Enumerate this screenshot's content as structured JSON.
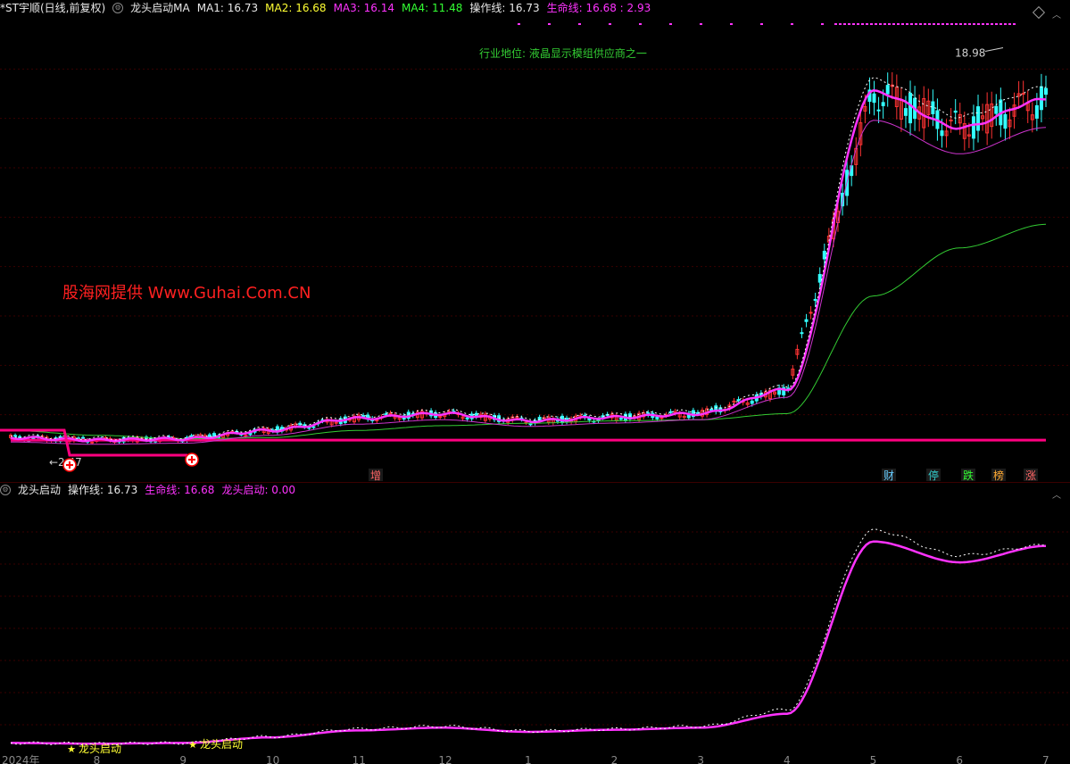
{
  "header": {
    "stock": "*ST宇顺(日线,前复权)",
    "indicator": "龙头启动MA",
    "ma1": "MA1: 16.73",
    "ma2": "MA2: 16.68",
    "ma3": "MA3: 16.14",
    "ma4": "MA4: 11.48",
    "op_line": "操作线: 16.73",
    "life_line": "生命线: 16.68 : 2.93"
  },
  "annotations": {
    "industry": "行业地位: 液晶显示模组供应商之一",
    "watermark": "股海网提供 Www.Guhai.Com.CN",
    "peak": "18.98",
    "low": "←2.47",
    "tags": [
      "增",
      "财",
      "停",
      "跌",
      "榜",
      "涨"
    ],
    "signal": "龙头启动"
  },
  "sub_header": {
    "name": "龙头启动",
    "op_line": "操作线: 16.73",
    "life_line": "生命线: 16.68",
    "signal": "龙头启动: 0.00"
  },
  "axis": {
    "x_labels": [
      "2024年",
      "8",
      "9",
      "10",
      "11",
      "12",
      "1",
      "2",
      "3",
      "4",
      "5",
      "6",
      "7"
    ]
  },
  "colors": {
    "up": "#ff3333",
    "down": "#33ffff",
    "ma1": "#ffffff",
    "ma2": "#ff33ff",
    "ma3": "#cc33cc",
    "ma4": "#33cc33",
    "op_line": "#ff0080"
  },
  "chart_data": [
    {
      "type": "line",
      "title": "",
      "x": [
        "2024-07",
        "2024-08",
        "2024-09",
        "2024-10",
        "2024-11",
        "2024-12",
        "2025-01",
        "2025-02",
        "2025-03",
        "2025-04",
        "2025-05",
        "2025-06",
        "2025-07"
      ],
      "series": [
        {
          "name": "MA2",
          "values": [
            2.6,
            2.5,
            2.55,
            2.9,
            3.4,
            3.6,
            3.3,
            3.45,
            3.6,
            4.6,
            17.0,
            15.5,
            16.68
          ]
        },
        {
          "name": "MA4",
          "values": [
            2.9,
            2.7,
            2.55,
            2.6,
            2.9,
            3.1,
            3.2,
            3.3,
            3.35,
            3.6,
            8.5,
            10.5,
            11.48
          ]
        },
        {
          "name": "操作线",
          "values": [
            2.5,
            2.5,
            2.5,
            2.5,
            2.5,
            2.5,
            2.5,
            2.5,
            2.5,
            2.5,
            2.5,
            2.5,
            2.5
          ]
        }
      ],
      "ylim": [
        1.5,
        20.0
      ],
      "peak_value": 18.98,
      "low_value": 2.47
    },
    {
      "type": "line",
      "title": "",
      "x": [
        "2024-07",
        "2024-08",
        "2024-09",
        "2024-10",
        "2024-11",
        "2024-12",
        "2025-01",
        "2025-02",
        "2025-03",
        "2025-04",
        "2025-05",
        "2025-06",
        "2025-07"
      ],
      "series": [
        {
          "name": "生命线",
          "values": [
            2.5,
            2.45,
            2.5,
            2.9,
            3.4,
            3.6,
            3.3,
            3.45,
            3.6,
            4.6,
            17.0,
            15.5,
            16.68
          ]
        },
        {
          "name": "操作线",
          "values": [
            2.5,
            2.45,
            2.5,
            2.95,
            3.5,
            3.7,
            3.35,
            3.5,
            3.7,
            4.9,
            17.8,
            16.0,
            16.73
          ]
        }
      ],
      "ylim": [
        1.5,
        20.0
      ]
    }
  ]
}
